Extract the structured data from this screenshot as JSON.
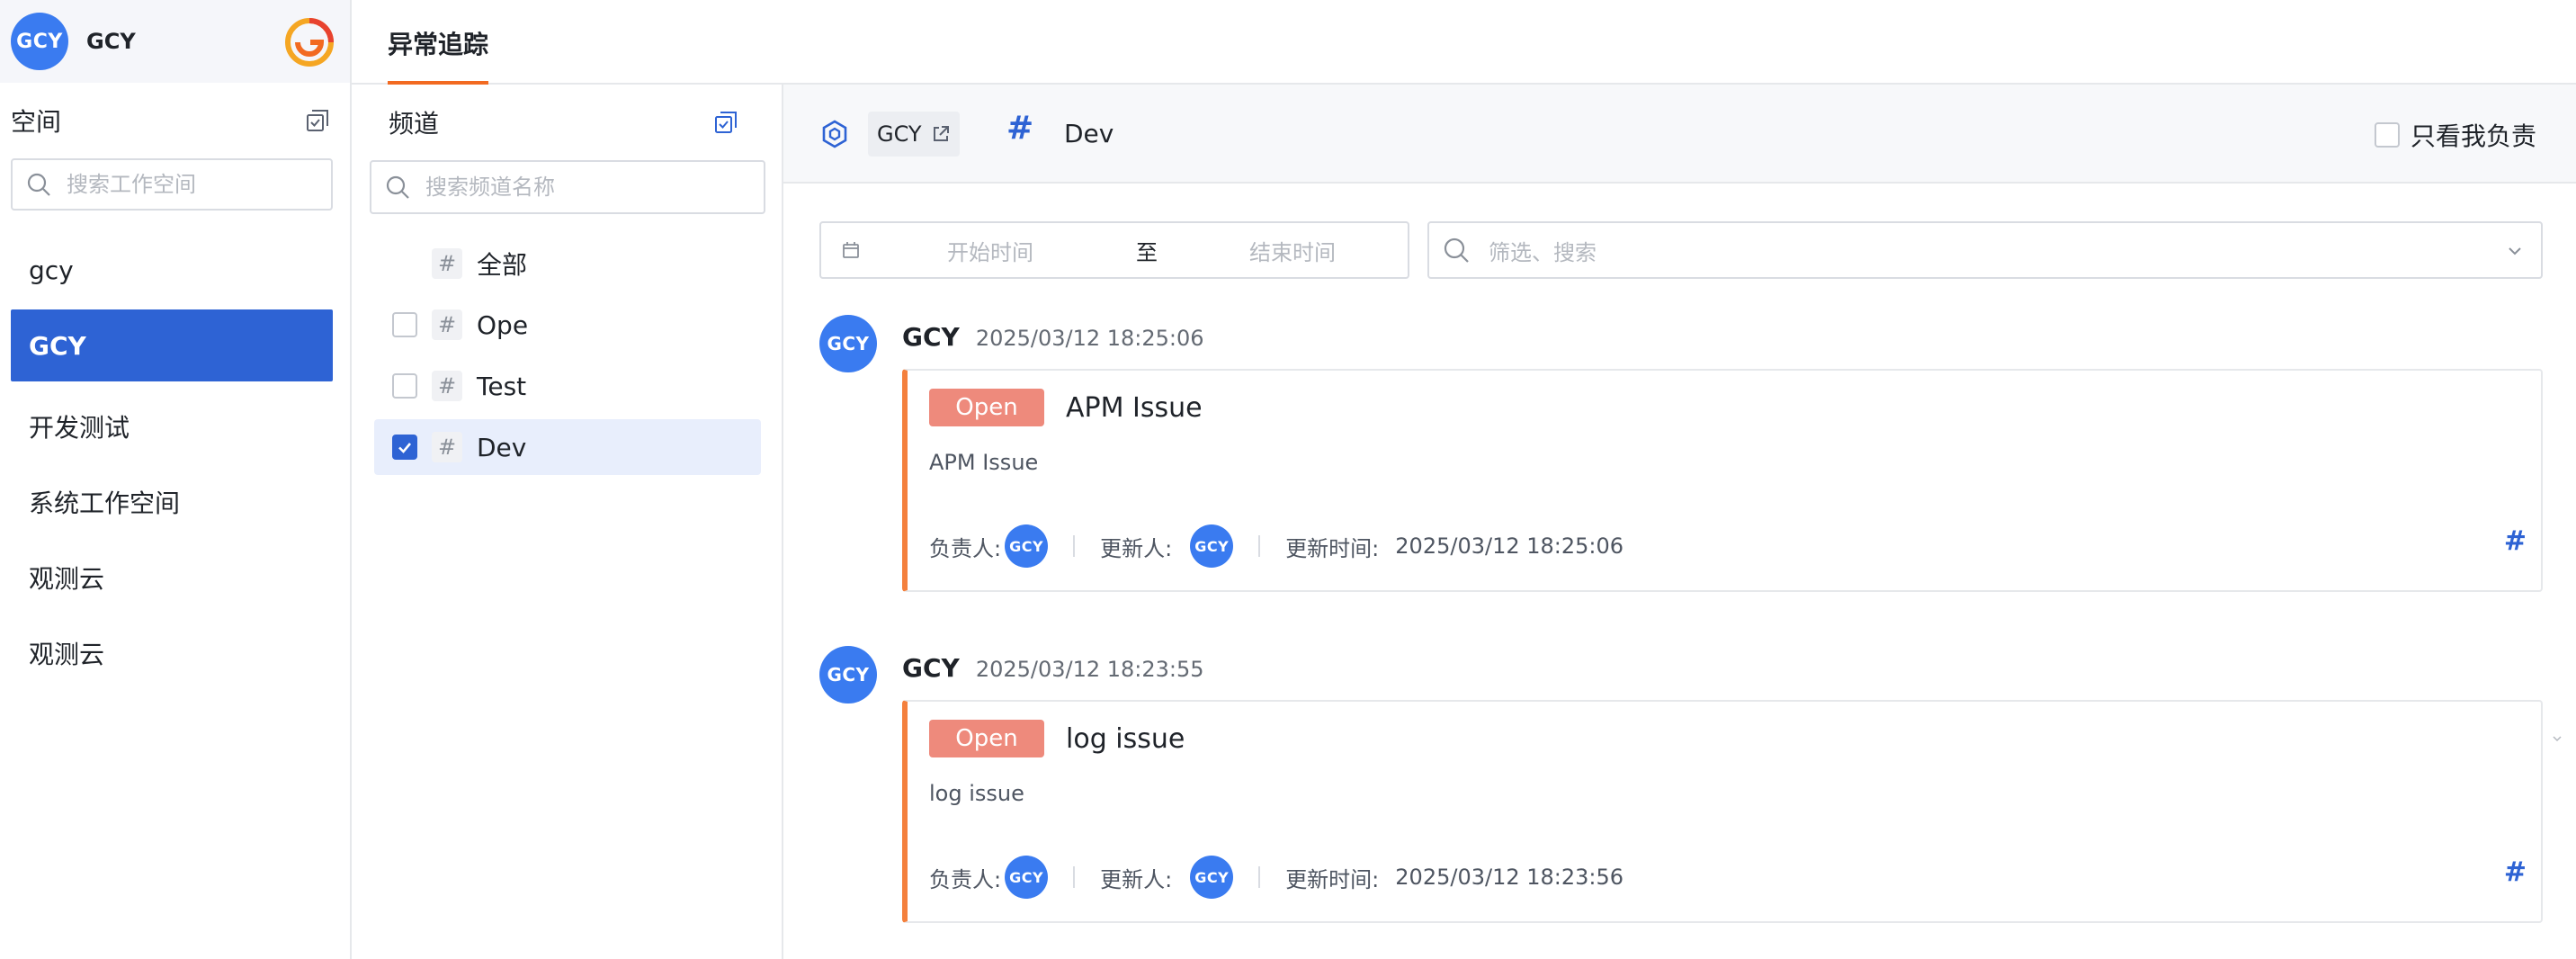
{
  "user": {
    "avatar_text": "GCY",
    "name": "GCY"
  },
  "sidebar": {
    "space_title": "空间",
    "search_placeholder": "搜索工作空间",
    "items": [
      {
        "label": "gcy"
      },
      {
        "label": "GCY"
      },
      {
        "label": "开发测试"
      },
      {
        "label": "系统工作空间"
      },
      {
        "label": "观测云"
      },
      {
        "label": "观测云"
      }
    ]
  },
  "topbar": {
    "tab_label": "异常追踪"
  },
  "channels": {
    "title": "频道",
    "search_placeholder": "搜索频道名称",
    "items": [
      {
        "label": "全部"
      },
      {
        "label": "Ope"
      },
      {
        "label": "Test"
      },
      {
        "label": "Dev"
      }
    ]
  },
  "main": {
    "workspace_chip": "GCY",
    "channel_hash": "#",
    "channel_name": "Dev",
    "only_mine_label": "只看我负责",
    "date_start_placeholder": "开始时间",
    "date_separator": "至",
    "date_end_placeholder": "结束时间",
    "filter_placeholder": "筛选、搜索"
  },
  "issues": [
    {
      "author_avatar": "GCY",
      "author": "GCY",
      "time": "2025/03/12 18:25:06",
      "status": "Open",
      "title": "APM Issue",
      "description": "APM Issue",
      "assignee_label": "负责人:",
      "assignee_avatar": "GCY",
      "updater_label": "更新人:",
      "updater_avatar": "GCY",
      "updated_label": "更新时间:",
      "updated_time": "2025/03/12 18:25:06",
      "hash": "#"
    },
    {
      "author_avatar": "GCY",
      "author": "GCY",
      "time": "2025/03/12 18:23:55",
      "status": "Open",
      "title": "log issue",
      "description": "log issue",
      "assignee_label": "负责人:",
      "assignee_avatar": "GCY",
      "updater_label": "更新人:",
      "updater_avatar": "GCY",
      "updated_label": "更新时间:",
      "updated_time": "2025/03/12 18:23:56",
      "hash": "#"
    }
  ],
  "colors": {
    "accent": "#2e63d4",
    "tab_underline": "#f26a21",
    "issue_border": "#f4803d",
    "open_badge": "#ee8a7c",
    "avatar": "#3a7bf0"
  }
}
